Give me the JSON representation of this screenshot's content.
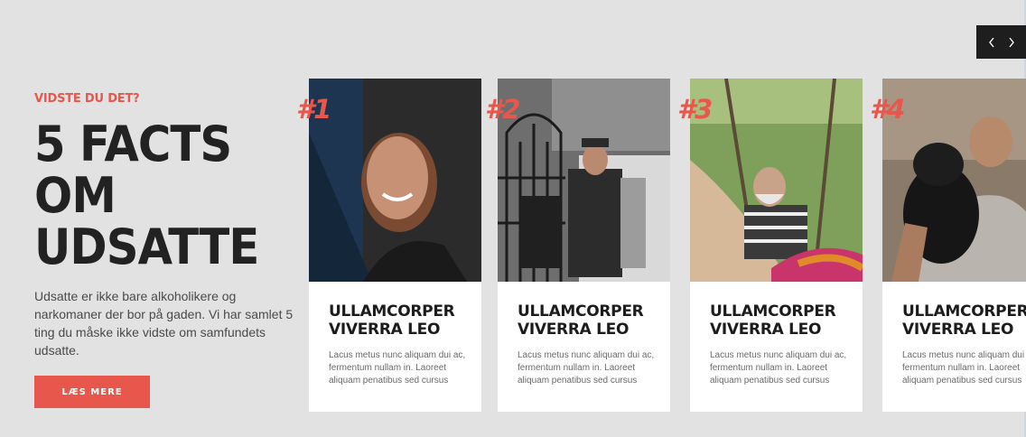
{
  "intro": {
    "eyebrow": "VIDSTE DU DET?",
    "headline_lines": [
      "5 FACTS",
      "OM",
      "UDSATTE"
    ],
    "text": "Udsatte er ikke bare alkoholikere og narkomaner der bor på gaden. Vi har samlet 5 ting du måske ikke vidste om samfundets udsatte.",
    "cta_label": "LÆS MERE"
  },
  "nav": {
    "prev": "‹",
    "next": "›"
  },
  "cards": [
    {
      "badge": "#1",
      "title": "ULLAMCORPER VIVERRA LEO",
      "text": "Lacus metus nunc aliquam dui ac, fermentum nullam in. Laoreet aliquam penatibus sed cursus"
    },
    {
      "badge": "#2",
      "title": "ULLAMCORPER VIVERRA LEO",
      "text": "Lacus metus nunc aliquam dui ac, fermentum nullam in. Laoreet aliquam penatibus sed cursus"
    },
    {
      "badge": "#3",
      "title": "ULLAMCORPER VIVERRA LEO",
      "text": "Lacus metus nunc aliquam dui ac, fermentum nullam in. Laoreet aliquam penatibus sed cursus"
    },
    {
      "badge": "#4",
      "title": "ULLAMCORPER VIVERRA LEO",
      "text": "Lacus metus nunc aliquam dui ac, fermentum nullam in. Laoreet aliquam penatibus sed cursus"
    }
  ],
  "colors": {
    "accent": "#e8574c",
    "background": "#e2e2e2",
    "dark": "#1e1e1e"
  }
}
